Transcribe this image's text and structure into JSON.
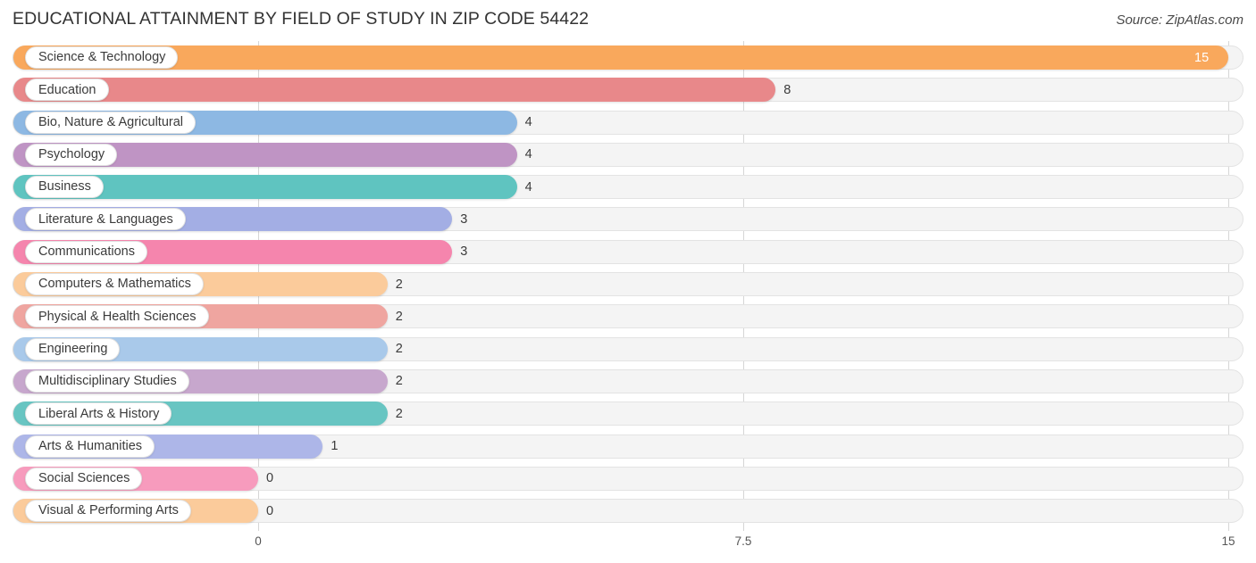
{
  "header": {
    "title": "EDUCATIONAL ATTAINMENT BY FIELD OF STUDY IN ZIP CODE 54422",
    "source": "Source: ZipAtlas.com"
  },
  "chart_data": {
    "type": "bar",
    "orientation": "horizontal",
    "title": "EDUCATIONAL ATTAINMENT BY FIELD OF STUDY IN ZIP CODE 54422",
    "xlabel": "",
    "ylabel": "",
    "xlim": [
      0,
      15
    ],
    "xticks": [
      "0",
      "7.5",
      "15"
    ],
    "xtick_values": [
      0,
      7.5,
      15
    ],
    "grid": true,
    "legend": "none",
    "categories": [
      "Science & Technology",
      "Education",
      "Bio, Nature & Agricultural",
      "Psychology",
      "Business",
      "Literature & Languages",
      "Communications",
      "Computers & Mathematics",
      "Physical & Health Sciences",
      "Engineering",
      "Multidisciplinary Studies",
      "Liberal Arts & History",
      "Arts & Humanities",
      "Social Sciences",
      "Visual & Performing Arts"
    ],
    "values": [
      15,
      8,
      4,
      4,
      4,
      3,
      3,
      2,
      2,
      2,
      2,
      2,
      1,
      0,
      0
    ],
    "value_labels": [
      "15",
      "8",
      "4",
      "4",
      "4",
      "3",
      "3",
      "2",
      "2",
      "2",
      "2",
      "2",
      "1",
      "0",
      "0"
    ],
    "colors": [
      "#f9a85c",
      "#e8888a",
      "#8db8e3",
      "#bf94c4",
      "#5fc4c0",
      "#a3aee4",
      "#f585ad",
      "#fbcb9b",
      "#efa5a0",
      "#a9c9ea",
      "#c7a7cd",
      "#68c5c2",
      "#adb6e8",
      "#f79bbd",
      "#fbcb9b"
    ]
  },
  "axis": {
    "ticks": [
      {
        "label": "0",
        "value": 0
      },
      {
        "label": "7.5",
        "value": 7.5
      },
      {
        "label": "15",
        "value": 15
      }
    ]
  }
}
